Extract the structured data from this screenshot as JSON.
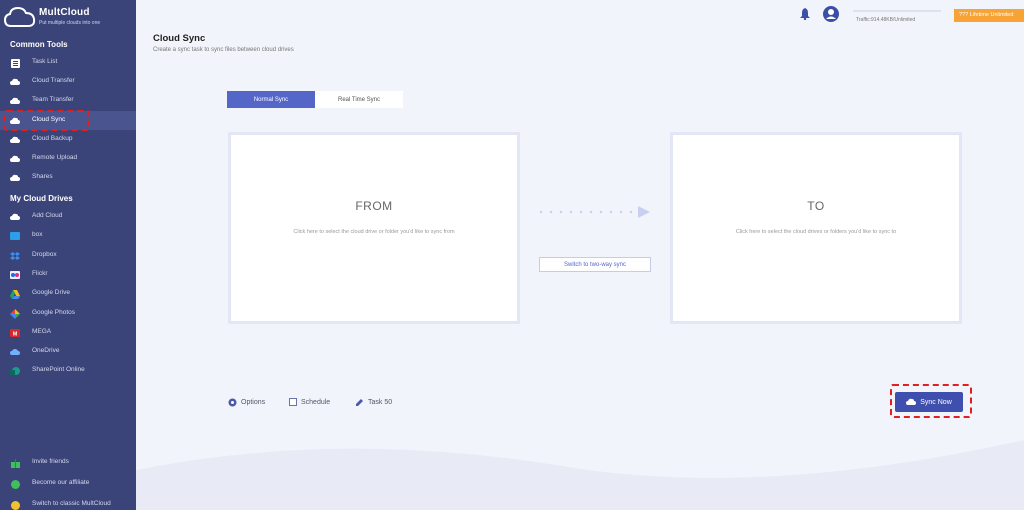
{
  "app": {
    "name": "MultCloud",
    "tagline": "Put multiple clouds into one"
  },
  "sidebar": {
    "common_tools_title": "Common Tools",
    "common_tools": [
      {
        "label": "Task List",
        "icon": "list-icon"
      },
      {
        "label": "Cloud Transfer",
        "icon": "cloud-transfer-icon"
      },
      {
        "label": "Team Transfer",
        "icon": "team-transfer-icon"
      },
      {
        "label": "Cloud Sync",
        "icon": "cloud-sync-icon"
      },
      {
        "label": "Cloud Backup",
        "icon": "cloud-backup-icon"
      },
      {
        "label": "Remote Upload",
        "icon": "remote-upload-icon"
      },
      {
        "label": "Shares",
        "icon": "share-icon"
      }
    ],
    "drives_title": "My Cloud Drives",
    "drives": [
      {
        "label": "Add Cloud",
        "icon": "add-cloud-icon"
      },
      {
        "label": "box",
        "icon": "box-icon"
      },
      {
        "label": "Dropbox",
        "icon": "dropbox-icon"
      },
      {
        "label": "Flickr",
        "icon": "flickr-icon"
      },
      {
        "label": "Google Drive",
        "icon": "google-drive-icon"
      },
      {
        "label": "Google Photos",
        "icon": "google-photos-icon"
      },
      {
        "label": "MEGA",
        "icon": "mega-icon"
      },
      {
        "label": "OneDrive",
        "icon": "onedrive-icon"
      },
      {
        "label": "SharePoint Online",
        "icon": "sharepoint-icon"
      }
    ],
    "footer": [
      {
        "label": "Invite friends",
        "icon": "gift-icon"
      },
      {
        "label": "Become our affiliate",
        "icon": "affiliate-icon"
      },
      {
        "label": "Switch to classic MultCloud",
        "icon": "switch-icon"
      }
    ]
  },
  "topbar": {
    "traffic": "Traffic:914.48KB/Unlimited",
    "lifetime": "??? Lifetime Unlimited"
  },
  "page": {
    "title": "Cloud Sync",
    "subtitle": "Create a sync task to sync files between cloud drives"
  },
  "tabs": {
    "normal": "Normal Sync",
    "realtime": "Real Time Sync"
  },
  "from_panel": {
    "title": "FROM",
    "hint": "Click here to select the cloud drive or folder you'd like to sync from"
  },
  "to_panel": {
    "title": "TO",
    "hint": "Click here to select the cloud drives or folders you'd like to sync to"
  },
  "switch_button": "Switch to two-way sync",
  "toolbar": {
    "options": "Options",
    "schedule": "Schedule",
    "task": "Task 50"
  },
  "sync_now": "Sync Now",
  "colors": {
    "sidebar": "#3b4478",
    "accent": "#5466c8",
    "button": "#3f4fae",
    "highlight": "#e02020"
  }
}
